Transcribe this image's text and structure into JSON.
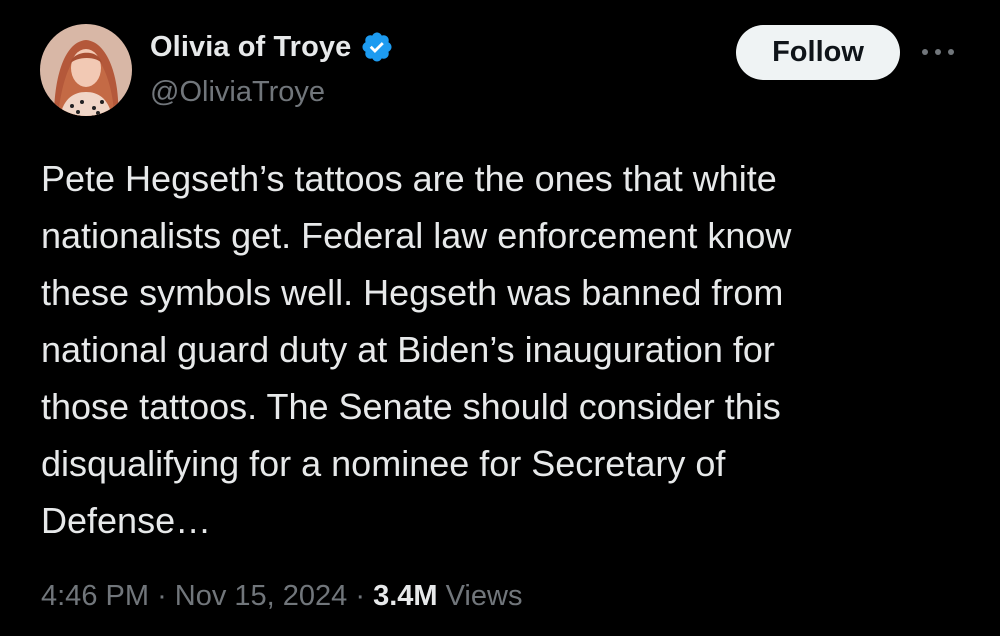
{
  "author": {
    "display_name": "Olivia of Troye",
    "handle": "@OliviaTroye",
    "verified_icon": "verified-badge-icon",
    "verified_color": "#1d9bf0"
  },
  "actions": {
    "follow_label": "Follow",
    "more_icon": "more-horizontal-icon"
  },
  "tweet": {
    "lines": [
      "Pete Hegseth’s tattoos are the ones that white",
      "nationalists get. Federal law enforcement know",
      "these symbols well. Hegseth was banned from",
      "national guard duty at Biden’s inauguration for",
      "those tattoos. The Senate should consider this",
      "disqualifying for a nominee for Secretary of",
      "Defense…"
    ]
  },
  "meta": {
    "time": "4:46 PM",
    "separator": "·",
    "date": "Nov 15, 2024",
    "views_count": "3.4M",
    "views_label": "Views"
  },
  "colors": {
    "background": "#000000",
    "text_primary": "#e7e9ea",
    "text_secondary": "#71767b",
    "follow_bg": "#eff3f4"
  }
}
